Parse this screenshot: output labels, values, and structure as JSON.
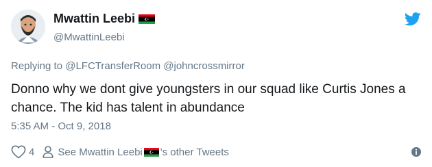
{
  "user": {
    "display_name": "Mwattin Leebi",
    "handle": "@MwattinLeebi"
  },
  "reply": {
    "prefix": "Replying to",
    "mentions": [
      "@LFCTransferRoom",
      "@johncrossmirror"
    ]
  },
  "tweet": {
    "text": "Donno why we dont give youngsters in our squad like Curtis Jones a chance. The kid has talent in abundance",
    "timestamp": "5:35 AM - Oct 9, 2018"
  },
  "actions": {
    "like_count": "4",
    "see_other_prefix": "See Mwattin Leebi",
    "see_other_suffix": "'s other Tweets"
  },
  "colors": {
    "text": "#14171a",
    "secondary": "#657786",
    "twitter_blue": "#1da1f2",
    "flag_red": "#e70013",
    "flag_black": "#000000",
    "flag_green": "#239e46"
  },
  "icons": {
    "brand": "twitter-bird-icon",
    "like": "heart-outline-icon",
    "profile": "person-icon",
    "info": "info-icon",
    "flag": "libya-flag-icon"
  }
}
